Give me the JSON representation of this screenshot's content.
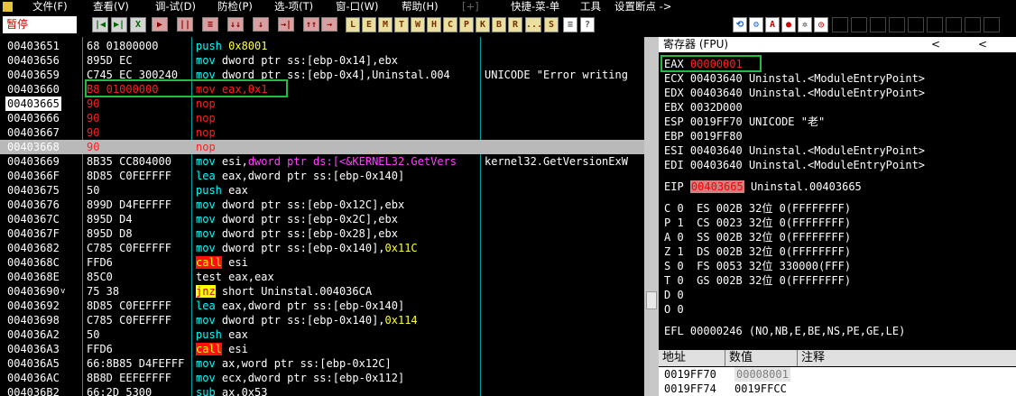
{
  "menu": [
    "文件(F)",
    "查看(V)",
    "调-试(D)",
    "防检(P)",
    "选-项(T)",
    "窗-口(W)",
    "帮助(H)",
    "[+]",
    "快捷-菜-单",
    "工具",
    "设置断点 ->"
  ],
  "toolbar": {
    "status": "暂停",
    "buttons_left": [
      "|◀",
      "▶|",
      "X",
      "▶",
      "||",
      "≡",
      "↓↓",
      "↓",
      "→|",
      "↑↑",
      "→"
    ],
    "buttons_letters": [
      "L",
      "E",
      "M",
      "T",
      "W",
      "H",
      "C",
      "P",
      "K",
      "B",
      "R",
      "...",
      "S"
    ]
  },
  "cpu": {
    "rows": [
      {
        "addr": "00403651",
        "hex": "68 01800000",
        "dis": [
          [
            "k",
            "push "
          ],
          [
            "n",
            "0x8001"
          ]
        ],
        "cmt": ""
      },
      {
        "addr": "00403656",
        "hex": "895D EC",
        "dis": [
          [
            "k",
            "mov "
          ],
          [
            "w",
            "dword ptr ss:[ebp-0x14],ebx"
          ]
        ],
        "cmt": ""
      },
      {
        "addr": "00403659",
        "hex": "C745 EC 300240",
        "dis": [
          [
            "k",
            "mov "
          ],
          [
            "w",
            "dword ptr ss:[ebp-0x4],Uninstal.004"
          ]
        ],
        "cmt": "UNICODE \"Error writing"
      },
      {
        "addr": "00403660",
        "hex": "B8 01000000",
        "dis": [
          [
            "r",
            "mov eax,0x1"
          ]
        ],
        "cmt": "",
        "red": true
      },
      {
        "addr": "00403665",
        "hex": "90",
        "dis": [
          [
            "r",
            "nop"
          ]
        ],
        "cmt": "",
        "red": true,
        "cur": true
      },
      {
        "addr": "00403666",
        "hex": "90",
        "dis": [
          [
            "r",
            "nop"
          ]
        ],
        "cmt": "",
        "red": true
      },
      {
        "addr": "00403667",
        "hex": "90",
        "dis": [
          [
            "r",
            "nop"
          ]
        ],
        "cmt": "",
        "red": true
      },
      {
        "addr": "00403668",
        "hex": "90",
        "dis": [
          [
            "r",
            "nop"
          ]
        ],
        "cmt": "",
        "red": true,
        "hl": true
      },
      {
        "addr": "00403669",
        "hex": "8B35 CC804000",
        "dis": [
          [
            "k",
            "mov "
          ],
          [
            "w",
            "esi,"
          ],
          [
            "m",
            "dword ptr ds:[<&KERNEL32.GetVers"
          ]
        ],
        "cmt": "kernel32.GetVersionExW"
      },
      {
        "addr": "0040366F",
        "hex": "8D85 C0FEFFFF",
        "dis": [
          [
            "k",
            "lea "
          ],
          [
            "w",
            "eax,dword ptr ss:[ebp-0x140]"
          ]
        ],
        "cmt": ""
      },
      {
        "addr": "00403675",
        "hex": "50",
        "dis": [
          [
            "k",
            "push "
          ],
          [
            "w",
            "eax"
          ]
        ],
        "cmt": ""
      },
      {
        "addr": "00403676",
        "hex": "899D D4FEFFFF",
        "dis": [
          [
            "k",
            "mov "
          ],
          [
            "w",
            "dword ptr ss:[ebp-0x12C],ebx"
          ]
        ],
        "cmt": ""
      },
      {
        "addr": "0040367C",
        "hex": "895D D4",
        "dis": [
          [
            "k",
            "mov "
          ],
          [
            "w",
            "dword ptr ss:[ebp-0x2C],ebx"
          ]
        ],
        "cmt": ""
      },
      {
        "addr": "0040367F",
        "hex": "895D D8",
        "dis": [
          [
            "k",
            "mov "
          ],
          [
            "w",
            "dword ptr ss:[ebp-0x28],ebx"
          ]
        ],
        "cmt": ""
      },
      {
        "addr": "00403682",
        "hex": "C785 C0FEFFFF",
        "dis": [
          [
            "k",
            "mov "
          ],
          [
            "w",
            "dword ptr ss:[ebp-0x140],"
          ],
          [
            "n",
            "0x11C"
          ]
        ],
        "cmt": ""
      },
      {
        "addr": "0040368C",
        "hex": "FFD6",
        "dis": [
          [
            "c",
            "call"
          ],
          [
            "w",
            " esi"
          ]
        ],
        "cmt": ""
      },
      {
        "addr": "0040368E",
        "hex": "85C0",
        "dis": [
          [
            "w",
            "test eax,eax"
          ]
        ],
        "cmt": ""
      },
      {
        "addr": "00403690",
        "hex": "75 38",
        "dis": [
          [
            "j",
            "jnz"
          ],
          [
            "w",
            " short Uninstal.004036CA"
          ]
        ],
        "cmt": "",
        "arrow": "v"
      },
      {
        "addr": "00403692",
        "hex": "8D85 C0FEFFFF",
        "dis": [
          [
            "k",
            "lea "
          ],
          [
            "w",
            "eax,dword ptr ss:[ebp-0x140]"
          ]
        ],
        "cmt": ""
      },
      {
        "addr": "00403698",
        "hex": "C785 C0FEFFFF",
        "dis": [
          [
            "k",
            "mov "
          ],
          [
            "w",
            "dword ptr ss:[ebp-0x140],"
          ],
          [
            "n",
            "0x114"
          ]
        ],
        "cmt": ""
      },
      {
        "addr": "004036A2",
        "hex": "50",
        "dis": [
          [
            "k",
            "push "
          ],
          [
            "w",
            "eax"
          ]
        ],
        "cmt": ""
      },
      {
        "addr": "004036A3",
        "hex": "FFD6",
        "dis": [
          [
            "c",
            "call"
          ],
          [
            "w",
            " esi"
          ]
        ],
        "cmt": ""
      },
      {
        "addr": "004036A5",
        "hex": "66:8B85 D4FEFFF",
        "dis": [
          [
            "k",
            "mov "
          ],
          [
            "w",
            "ax,word ptr ss:[ebp-0x12C]"
          ]
        ],
        "cmt": ""
      },
      {
        "addr": "004036AC",
        "hex": "8B8D EEFEFFFF",
        "dis": [
          [
            "k",
            "mov "
          ],
          [
            "w",
            "ecx,dword ptr ss:[ebp-0x112]"
          ]
        ],
        "cmt": ""
      },
      {
        "addr": "004036B2",
        "hex": "66:2D 5300",
        "dis": [
          [
            "k",
            "sub "
          ],
          [
            "w",
            "ax,0x53"
          ]
        ],
        "cmt": ""
      }
    ]
  },
  "registers": {
    "title": "寄存器 (FPU)",
    "arrow_left": "<",
    "arrow_left2": "<",
    "gp": [
      {
        "name": "EAX",
        "val": "00000001",
        "txt": "",
        "red": true
      },
      {
        "name": "ECX",
        "val": "00403640",
        "txt": "Uninstal.<ModuleEntryPoint>"
      },
      {
        "name": "EDX",
        "val": "00403640",
        "txt": "Uninstal.<ModuleEntryPoint>"
      },
      {
        "name": "EBX",
        "val": "0032D000",
        "txt": ""
      },
      {
        "name": "ESP",
        "val": "0019FF70",
        "txt": "UNICODE \"老\""
      },
      {
        "name": "EBP",
        "val": "0019FF80",
        "txt": ""
      },
      {
        "name": "ESI",
        "val": "00403640",
        "txt": "Uninstal.<ModuleEntryPoint>"
      },
      {
        "name": "EDI",
        "val": "00403640",
        "txt": "Uninstal.<ModuleEntryPoint>"
      }
    ],
    "eip": {
      "name": "EIP",
      "val": "00403665",
      "txt": "Uninstal.00403665"
    },
    "flags": [
      "C 0  ES 002B 32位 0(FFFFFFFF)",
      "P 1  CS 0023 32位 0(FFFFFFFF)",
      "A 0  SS 002B 32位 0(FFFFFFFF)",
      "Z 1  DS 002B 32位 0(FFFFFFFF)",
      "S 0  FS 0053 32位 330000(FFF)",
      "T 0  GS 002B 32位 0(FFFFFFFF)",
      "D 0",
      "O 0"
    ],
    "efl": "EFL 00000246 (NO,NB,E,BE,NS,PE,GE,LE)"
  },
  "stack": {
    "headers": [
      "地址",
      "数值",
      "注释"
    ],
    "rows": [
      {
        "addr": "0019FF70",
        "val": "00008001"
      },
      {
        "addr": "0019FF74",
        "val": "0019FFCC"
      }
    ]
  }
}
